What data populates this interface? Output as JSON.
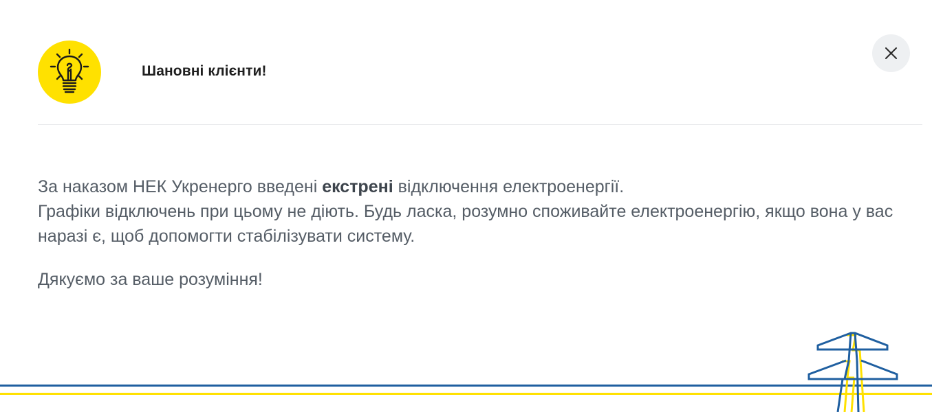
{
  "modal": {
    "title": "Шановні клієнти!",
    "close_label": "close",
    "message": {
      "line1_before": "За наказом НЕК Укренерго введені ",
      "line1_emphasis": "екстрені",
      "line1_after": " відключення електроенергії.",
      "line2": "Графіки відключень при цьому не діють.  Будь ласка, розумно споживайте електроенергію, якщо вона у вас наразі є, щоб допомогти стабілізувати систему.",
      "thanks": "Дякуємо за ваше розуміння!"
    }
  },
  "icons": {
    "badge_icon": "lightbulb-icon",
    "close_icon": "close-icon",
    "decoration": "power-pylon-icon"
  },
  "colors": {
    "badge_yellow": "#ffe100",
    "text_gray": "#555d66",
    "line_blue": "#1f5fa0",
    "line_yellow": "#ffe100"
  }
}
